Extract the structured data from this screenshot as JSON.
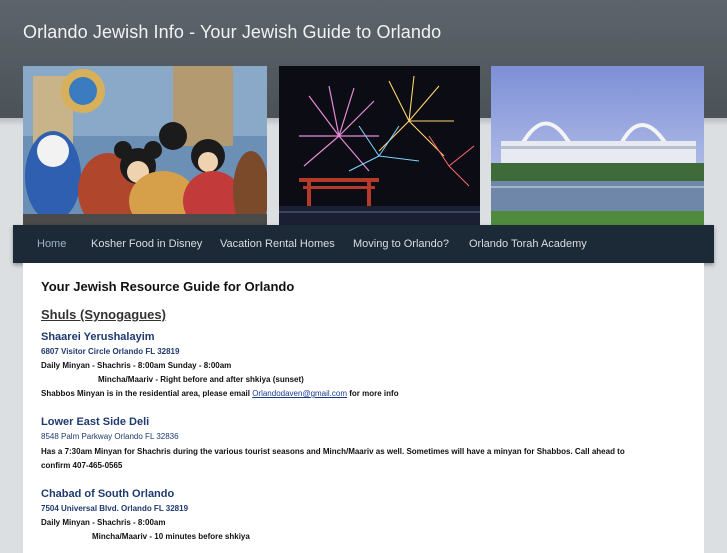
{
  "header": {
    "site_title": "Orlando Jewish Info - Your Jewish Guide to Orlando"
  },
  "banner": {
    "images": [
      "Disney characters photo",
      "Fireworks photo",
      "Convention center photo"
    ]
  },
  "nav": {
    "items": [
      {
        "label": "Home",
        "active": true
      },
      {
        "label": "Kosher Food in Disney"
      },
      {
        "label": "Vacation Rental Homes"
      },
      {
        "label": "Moving to Orlando?"
      },
      {
        "label": "Orlando Torah Academy"
      }
    ]
  },
  "main": {
    "title": "Your Jewish Resource Guide for Orlando",
    "section_heading": "Shuls (Synogagues)",
    "shuls": [
      {
        "name": "Shaarei Yerushalayim",
        "address": "6807 Visitor Circle Orlando FL 32819",
        "line1": "Daily Minyan - Shachris - 8:00am     Sunday - 8:00am",
        "line2": "Mincha/Maariv - Right before and after shkiya (sunset)",
        "line3_prefix": "Shabbos Minyan is in the residential area, please email ",
        "email": "Orlandodaven@gmail.com",
        "line3_suffix": " for more info"
      },
      {
        "name": "Lower East Side Deli",
        "address": "8548 Palm Parkway Orlando FL 32836",
        "line1": "Has a 7:30am Minyan for Shachris during the various tourist seasons and Minch/Maariv as well. Sometimes will have a minyan for Shabbos. Call ahead to",
        "line2": "confirm 407-465-0565"
      },
      {
        "name": "Chabad of South Orlando",
        "address": "7504 Universal Blvd. Orlando FL 32819",
        "line1": "Daily Minyan - Shachris - 8:00am",
        "line2": "Mincha/Maariv - 10 minutes before shkiya"
      }
    ]
  }
}
